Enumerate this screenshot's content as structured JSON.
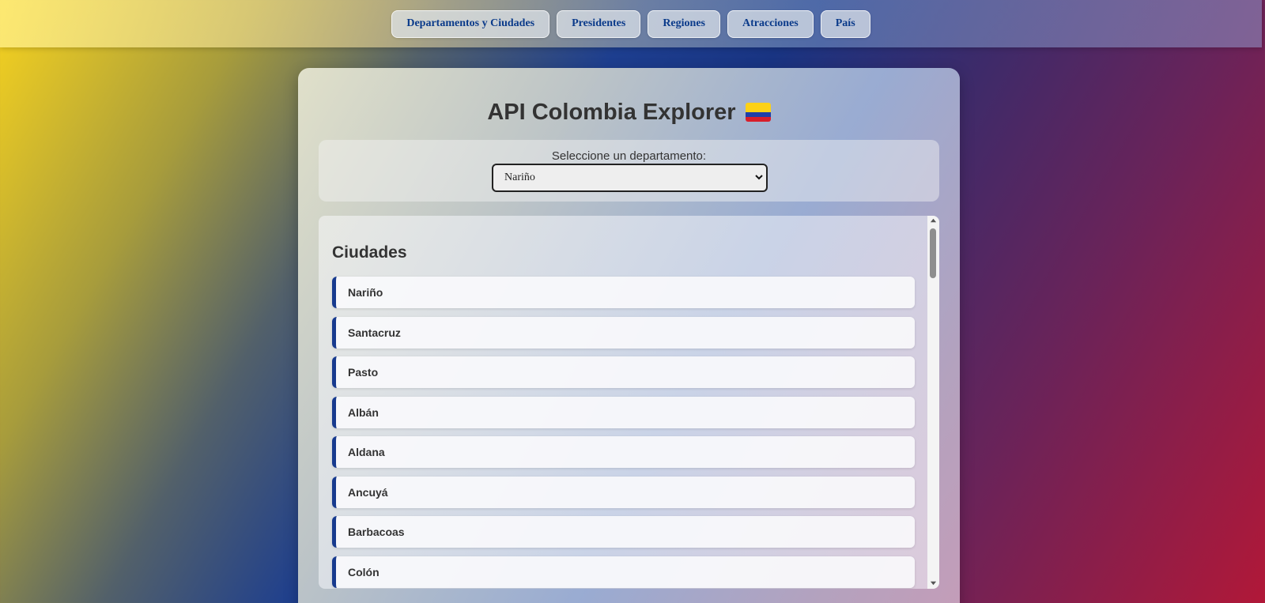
{
  "nav": {
    "items": [
      {
        "label": "Departamentos y Ciudades"
      },
      {
        "label": "Presidentes"
      },
      {
        "label": "Regiones"
      },
      {
        "label": "Atracciones"
      },
      {
        "label": "País"
      }
    ]
  },
  "main": {
    "title": "API Colombia Explorer",
    "flag_icon": "colombia-flag-icon",
    "selector": {
      "label": "Seleccione un departamento:",
      "selected_value": "Nariño"
    },
    "cities": {
      "heading": "Ciudades",
      "items": [
        "Nariño",
        "Santacruz",
        "Pasto",
        "Albán",
        "Aldana",
        "Ancuyá",
        "Barbacoas",
        "Colón"
      ]
    }
  },
  "colors": {
    "accent_blue": "#173a8e",
    "nav_text": "#0a3a8a",
    "flag_yellow": "#fcd116",
    "flag_blue": "#1f3fa8",
    "flag_red": "#d81e2a"
  }
}
